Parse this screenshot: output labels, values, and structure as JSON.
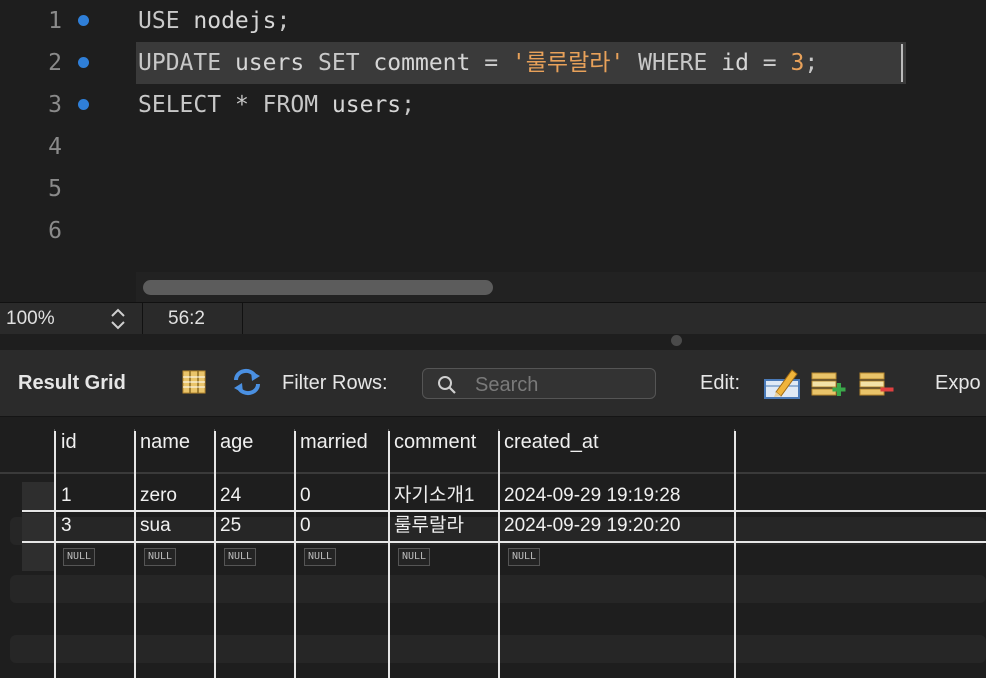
{
  "editor": {
    "line_numbers": [
      "1",
      "2",
      "3",
      "4",
      "5",
      "6"
    ],
    "lines": [
      {
        "tokens": [
          {
            "t": "USE",
            "c": "kw"
          },
          {
            "t": " nodejs",
            "c": ""
          },
          {
            "t": ";",
            "c": "sym"
          }
        ]
      },
      {
        "tokens": [
          {
            "t": "UPDATE",
            "c": "kw"
          },
          {
            "t": " users ",
            "c": ""
          },
          {
            "t": "SET",
            "c": "kw"
          },
          {
            "t": " comment ",
            "c": ""
          },
          {
            "t": "=",
            "c": "sym"
          },
          {
            "t": " ",
            "c": ""
          },
          {
            "t": "'룰루랄라'",
            "c": "str"
          },
          {
            "t": " ",
            "c": ""
          },
          {
            "t": "WHERE",
            "c": "kw"
          },
          {
            "t": " id ",
            "c": ""
          },
          {
            "t": "=",
            "c": "sym"
          },
          {
            "t": " ",
            "c": ""
          },
          {
            "t": "3",
            "c": "num"
          },
          {
            "t": ";",
            "c": "sym"
          }
        ]
      },
      {
        "tokens": [
          {
            "t": "SELECT",
            "c": "kw"
          },
          {
            "t": " ",
            "c": ""
          },
          {
            "t": "*",
            "c": "sym"
          },
          {
            "t": " ",
            "c": ""
          },
          {
            "t": "FROM",
            "c": "kw"
          },
          {
            "t": " users",
            "c": ""
          },
          {
            "t": ";",
            "c": "sym"
          }
        ]
      }
    ],
    "colors": {
      "keyword": "#c8c8c8",
      "string": "#e8a15a",
      "number": "#e8a15a",
      "marker": "#2f7fd8"
    }
  },
  "statusbar": {
    "zoom": "100%",
    "cursor_position": "56:2"
  },
  "toolbar": {
    "result_grid_label": "Result Grid",
    "filter_rows_label": "Filter Rows:",
    "search_placeholder": "Search",
    "edit_label": "Edit:",
    "export_label": "Expo",
    "icons": [
      "grid-view-icon",
      "refresh-icon",
      "search-icon",
      "edit-cell-icon",
      "add-row-icon",
      "delete-row-icon"
    ]
  },
  "grid": {
    "columns": [
      "id",
      "name",
      "age",
      "married",
      "comment",
      "created_at"
    ],
    "rows": [
      [
        "1",
        "zero",
        "24",
        "0",
        "자기소개1",
        "2024-09-29 19:19:28"
      ],
      [
        "3",
        "sua",
        "25",
        "0",
        "룰루랄라",
        "2024-09-29 19:20:20"
      ]
    ],
    "null_label": "NULL"
  }
}
